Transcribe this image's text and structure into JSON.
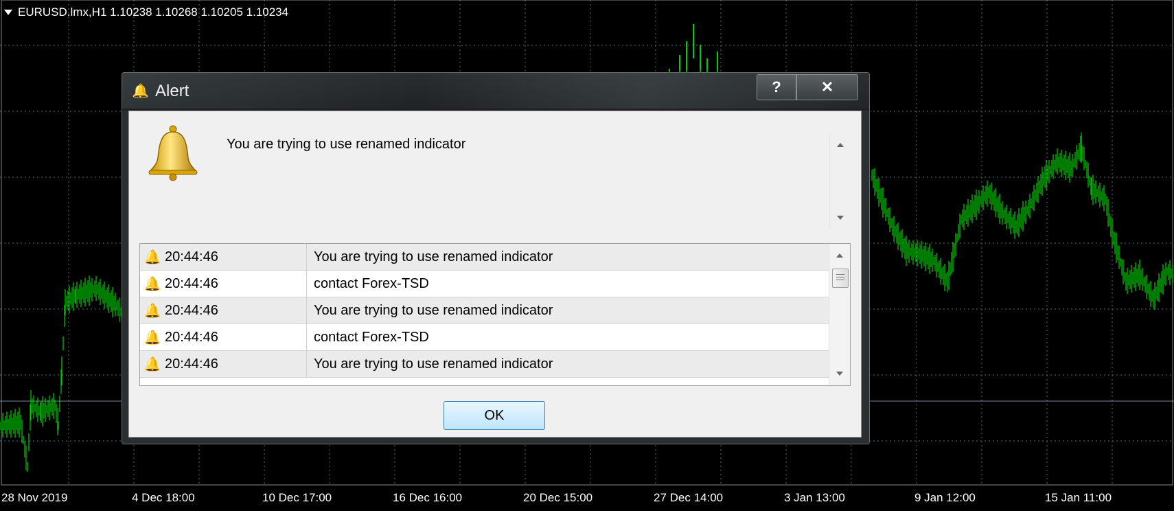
{
  "chart": {
    "header": "EURUSD.lmx,H1  1.10238 1.10268 1.10205 1.10234",
    "dates": [
      "28 Nov 2019",
      "4 Dec 18:00",
      "10 Dec 17:00",
      "16 Dec 16:00",
      "20 Dec 15:00",
      "27 Dec 14:00",
      "3 Jan 13:00",
      "9 Jan 12:00",
      "15 Jan 11:00"
    ],
    "line_color": "#00d000",
    "grid_color": "#5a6a7a"
  },
  "dialog": {
    "title": "Alert",
    "help_label": "?",
    "close_label": "✕",
    "message": "You are trying to use renamed indicator",
    "log": [
      {
        "time": "20:44:46",
        "text": "You are trying to use renamed indicator"
      },
      {
        "time": "20:44:46",
        "text": "contact Forex-TSD"
      },
      {
        "time": "20:44:46",
        "text": "You are trying to use renamed indicator"
      },
      {
        "time": "20:44:46",
        "text": "contact Forex-TSD"
      },
      {
        "time": "20:44:46",
        "text": "You are trying to use renamed indicator"
      }
    ],
    "ok_label": "OK"
  }
}
